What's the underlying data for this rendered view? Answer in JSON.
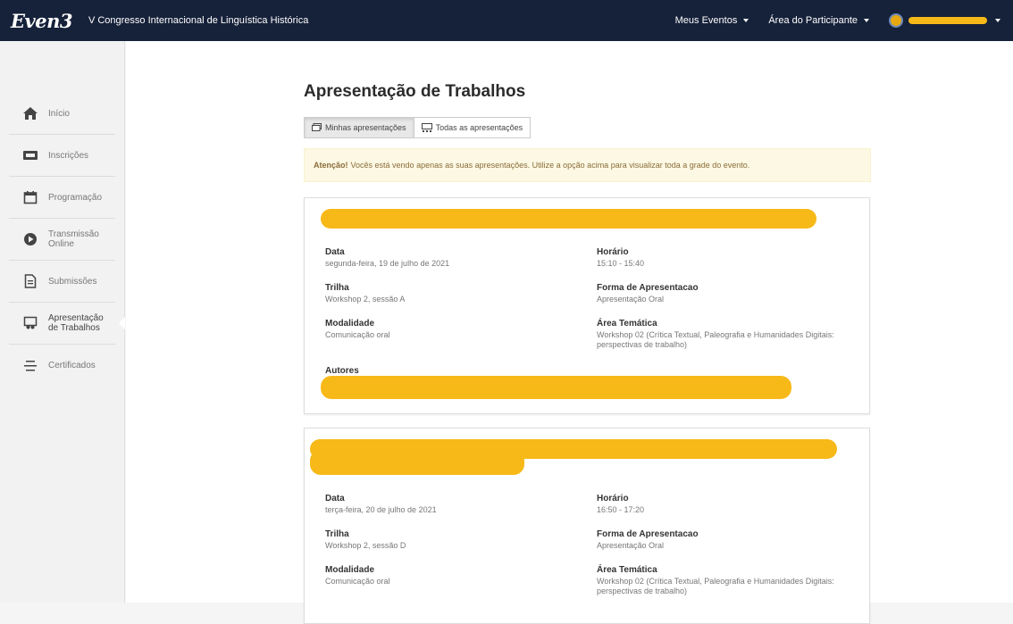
{
  "topbar": {
    "logo": "Even3",
    "event_title": "V Congresso Internacional de Linguística Histórica",
    "menu_events": "Meus Eventos",
    "menu_participant": "Área do Participante"
  },
  "sidebar": {
    "items": [
      {
        "label": "Início",
        "icon": "home-icon"
      },
      {
        "label": "Inscrições",
        "icon": "ticket-icon"
      },
      {
        "label": "Programação",
        "icon": "calendar-icon"
      },
      {
        "label": "Transmissão Online",
        "icon": "play-icon"
      },
      {
        "label": "Submissões",
        "icon": "document-icon"
      },
      {
        "label": "Apresentação de Trabalhos",
        "icon": "presentation-icon"
      },
      {
        "label": "Certificados",
        "icon": "certificate-icon"
      }
    ]
  },
  "main": {
    "title": "Apresentação de Trabalhos",
    "tab_mine": "Minhas apresentações",
    "tab_all": "Todas as apresentações",
    "alert_strong": "Atenção!",
    "alert_text": "Vocês está vendo apenas as suas apresentações. Utilize a opção acima para visualizar toda a grade do evento."
  },
  "cards": [
    {
      "data_label": "Data",
      "data_value": "segunda-feira, 19 de julho de 2021",
      "horario_label": "Horário",
      "horario_value": "15:10 - 15:40",
      "trilha_label": "Trilha",
      "trilha_value": "Workshop 2, sessão A",
      "forma_label": "Forma de Apresentacao",
      "forma_value": "Apresentação Oral",
      "modalidade_label": "Modalidade",
      "modalidade_value": "Comunicação oral",
      "area_label": "Área Temática",
      "area_value": "Workshop 02 (Crítica Textual, Paleografia e Humanidades Digitais: perspectivas de trabalho)",
      "autores_label": "Autores"
    },
    {
      "data_label": "Data",
      "data_value": "terça-feira, 20 de julho de 2021",
      "horario_label": "Horário",
      "horario_value": "16:50 - 17:20",
      "trilha_label": "Trilha",
      "trilha_value": "Workshop 2, sessão D",
      "forma_label": "Forma de Apresentacao",
      "forma_value": "Apresentação Oral",
      "modalidade_label": "Modalidade",
      "modalidade_value": "Comunicação oral",
      "area_label": "Área Temática",
      "area_value": "Workshop 02 (Crítica Textual, Paleografia e Humanidades Digitais: perspectivas de trabalho)"
    }
  ],
  "colors": {
    "topbar": "#16213a",
    "redaction": "#f7b918",
    "alert_bg": "#fcf8e3"
  }
}
